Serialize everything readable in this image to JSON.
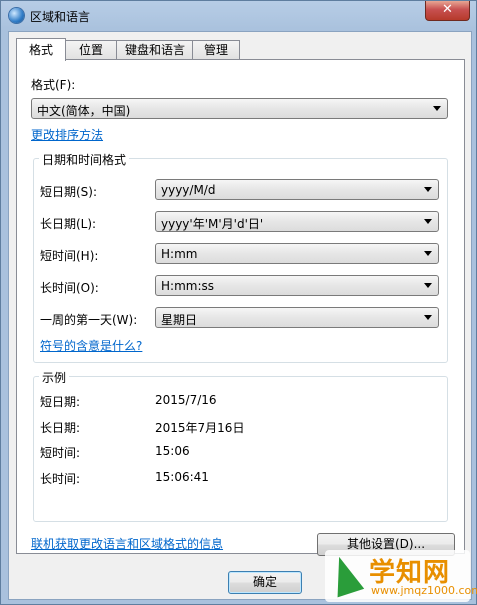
{
  "window": {
    "title": "区域和语言",
    "close_glyph": "✕"
  },
  "tabs": [
    {
      "label": "格式",
      "active": true
    },
    {
      "label": "位置",
      "active": false
    },
    {
      "label": "键盘和语言",
      "active": false
    },
    {
      "label": "管理",
      "active": false
    }
  ],
  "format": {
    "label": "格式(F):",
    "value": "中文(简体，中国)",
    "sort_link": "更改排序方法"
  },
  "datetime": {
    "group_title": "日期和时间格式",
    "rows": [
      {
        "label": "短日期(S):",
        "value": "yyyy/M/d"
      },
      {
        "label": "长日期(L):",
        "value": "yyyy'年'M'月'd'日'"
      },
      {
        "label": "短时间(H):",
        "value": "H:mm"
      },
      {
        "label": "长时间(O):",
        "value": "H:mm:ss"
      },
      {
        "label": "一周的第一天(W):",
        "value": "星期日"
      }
    ],
    "meaning_link": "符号的含意是什么?"
  },
  "examples": {
    "group_title": "示例",
    "rows": [
      {
        "label": "短日期:",
        "value": "2015/7/16"
      },
      {
        "label": "长日期:",
        "value": "2015年7月16日"
      },
      {
        "label": "短时间:",
        "value": "15:06"
      },
      {
        "label": "长时间:",
        "value": "15:06:41"
      }
    ]
  },
  "other_settings_label": "其他设置(D)...",
  "online_link": "联机获取更改语言和区域格式的信息",
  "ok_label": "确定",
  "watermark": {
    "main": "学知网",
    "sub": "www.jmqz1000.com"
  }
}
